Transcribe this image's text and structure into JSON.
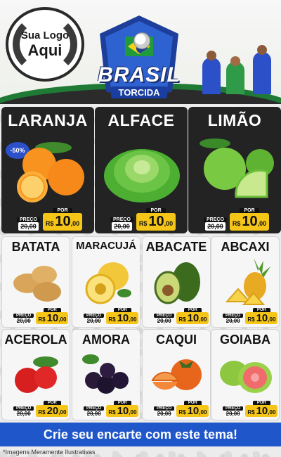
{
  "header": {
    "logo_line1": "Sua Logo",
    "logo_line2": "Aqui",
    "badge_title": "BRASIL",
    "badge_subtitle": "TORCIDA"
  },
  "featured": [
    {
      "name": "LARANJA",
      "discount": "-50%",
      "old_label": "PREÇO",
      "old_price": "20,00",
      "new_label": "POR",
      "currency": "R$",
      "price_int": "10",
      "price_cents": ",00",
      "unit": "KG"
    },
    {
      "name": "ALFACE",
      "old_label": "PREÇO",
      "old_price": "20,00",
      "new_label": "POR",
      "currency": "R$",
      "price_int": "10",
      "price_cents": ",00",
      "unit": "UNI"
    },
    {
      "name": "LIMÃO",
      "old_label": "PREÇO",
      "old_price": "20,00",
      "new_label": "POR",
      "currency": "R$",
      "price_int": "10",
      "price_cents": ",00",
      "unit": "KG"
    }
  ],
  "products": [
    {
      "name": "BATATA",
      "old_label": "PREÇO",
      "old_price": "20,00",
      "new_label": "POR",
      "currency": "R$",
      "price_int": "10",
      "price_cents": ",00"
    },
    {
      "name": "MARACUJÁ",
      "old_label": "PREÇO",
      "old_price": "20,00",
      "new_label": "POR",
      "currency": "R$",
      "price_int": "10",
      "price_cents": ",00"
    },
    {
      "name": "ABACATE",
      "old_label": "PREÇO",
      "old_price": "20,00",
      "new_label": "POR",
      "currency": "R$",
      "price_int": "10",
      "price_cents": ",00"
    },
    {
      "name": "ABCAXI",
      "old_label": "PREÇO",
      "old_price": "20,00",
      "new_label": "POR",
      "currency": "R$",
      "price_int": "10",
      "price_cents": ",00"
    },
    {
      "name": "ACEROLA",
      "old_label": "PREÇO",
      "old_price": "20,00",
      "new_label": "POR",
      "currency": "R$",
      "price_int": "20",
      "price_cents": ",00"
    },
    {
      "name": "AMORA",
      "old_label": "PREÇO",
      "old_price": "20,00",
      "new_label": "POR",
      "currency": "R$",
      "price_int": "10",
      "price_cents": ",00"
    },
    {
      "name": "CAQUI",
      "old_label": "PREÇO",
      "old_price": "20,00",
      "new_label": "POR",
      "currency": "R$",
      "price_int": "10",
      "price_cents": ",00"
    },
    {
      "name": "GOIABA",
      "old_label": "PREÇO",
      "old_price": "20,00",
      "new_label": "POR",
      "currency": "R$",
      "price_int": "10",
      "price_cents": ",00"
    }
  ],
  "footer": {
    "cta": "Crie seu encarte com este tema!",
    "disclaimer": "*Imagens Meramente Ilustrativas"
  },
  "colors": {
    "accent_blue": "#1f56c9",
    "price_yellow": "#f5c518",
    "card_dark": "#232323",
    "brazil_green": "#1e7a34"
  }
}
